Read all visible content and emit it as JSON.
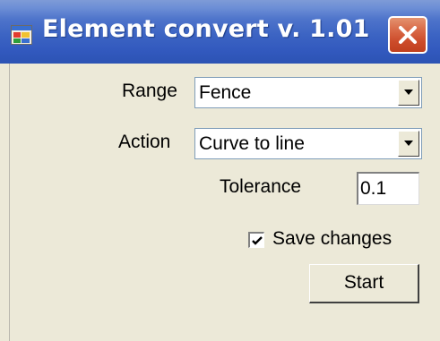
{
  "window": {
    "title": "Element convert v. 1.01",
    "icon": "app-window-icon",
    "close_icon": "close-icon"
  },
  "form": {
    "range": {
      "label": "Range",
      "selected": "Fence"
    },
    "action": {
      "label": "Action",
      "selected": "Curve to line"
    },
    "tolerance": {
      "label": "Tolerance",
      "value": "0.1"
    },
    "save_changes": {
      "label": "Save changes",
      "checked": true
    },
    "start_button": "Start"
  },
  "colors": {
    "titlebar": "#3259be",
    "close_button": "#cc4b2a",
    "background": "#ece9d8"
  }
}
